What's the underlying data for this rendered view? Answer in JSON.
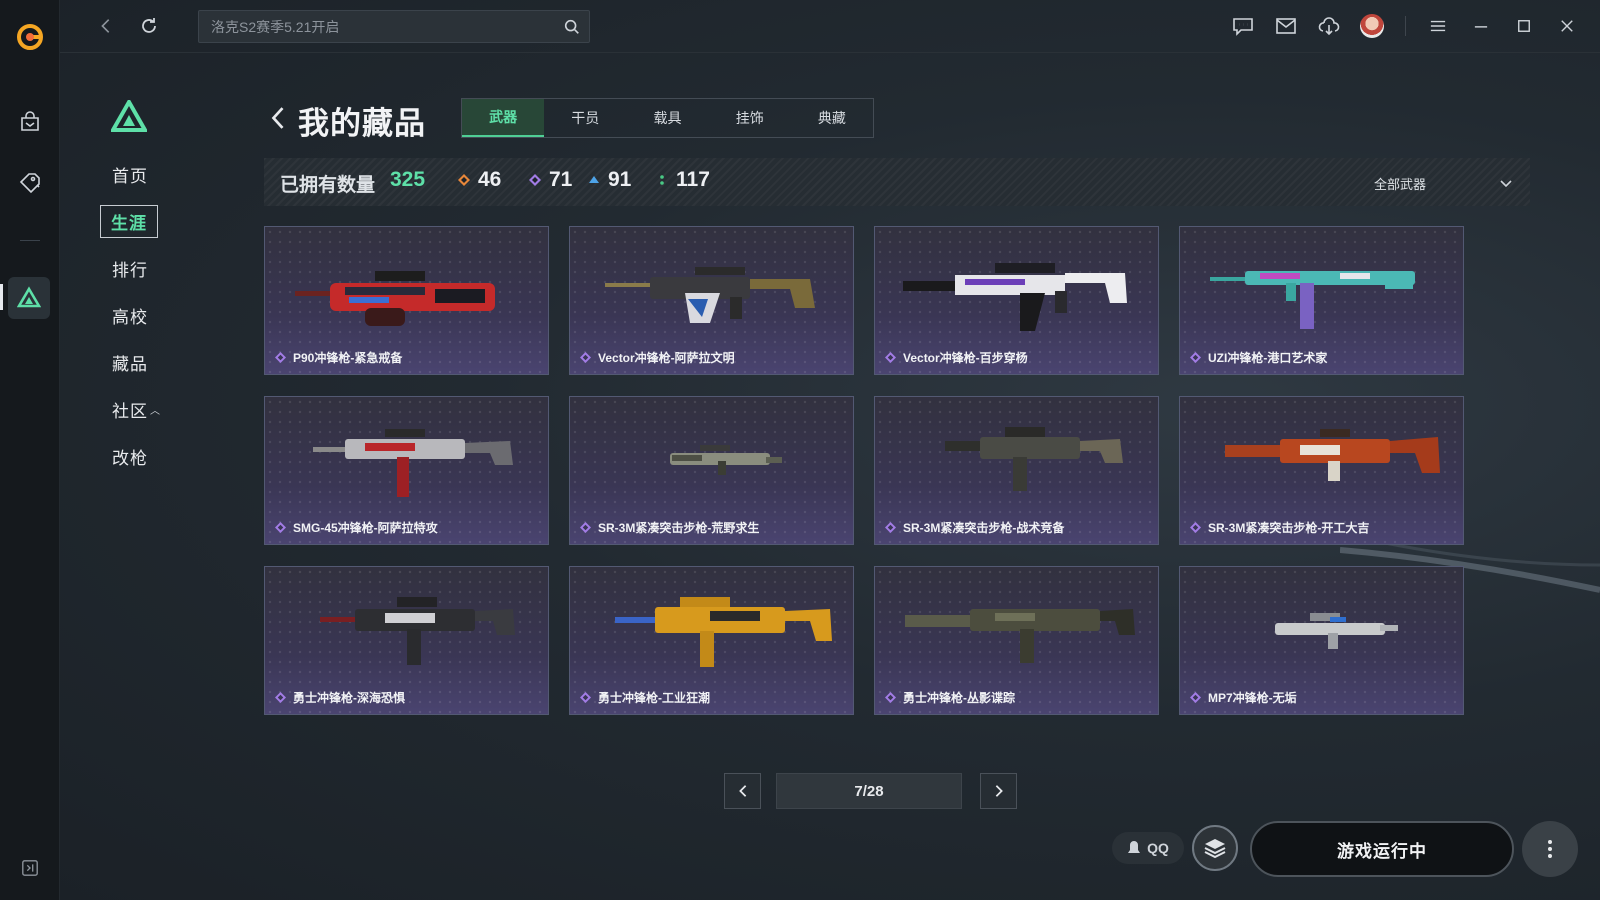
{
  "search": {
    "placeholder": "洛克S2赛季5.21开启"
  },
  "sidebar": {
    "items": [
      {
        "label": "首页"
      },
      {
        "label": "生涯"
      },
      {
        "label": "排行"
      },
      {
        "label": "高校"
      },
      {
        "label": "藏品"
      },
      {
        "label": "社区"
      },
      {
        "label": "改枪"
      }
    ],
    "active": "生涯"
  },
  "page": {
    "title": "我的藏品"
  },
  "tabs": [
    "武器",
    "干员",
    "载具",
    "挂饰",
    "典藏"
  ],
  "active_tab": "武器",
  "stats": {
    "owned_label": "已拥有数量",
    "owned_count": "325",
    "orange": "46",
    "purple": "71",
    "blue": "91",
    "green": "117",
    "filter": "全部武器"
  },
  "colors": {
    "accent_green": "#5ee0a8",
    "rarity_orange": "#e8873a",
    "rarity_purple": "#a27ce6",
    "rarity_blue": "#4da3e8",
    "rarity_green": "#49c985"
  },
  "items": [
    {
      "name": "P90冲锋枪-紧急戒备"
    },
    {
      "name": "Vector冲锋枪-阿萨拉文明"
    },
    {
      "name": "Vector冲锋枪-百步穿杨"
    },
    {
      "name": "UZI冲锋枪-港口艺术家"
    },
    {
      "name": "SMG-45冲锋枪-阿萨拉特攻"
    },
    {
      "name": "SR-3M紧凑突击步枪-荒野求生"
    },
    {
      "name": "SR-3M紧凑突击步枪-战术竞备"
    },
    {
      "name": "SR-3M紧凑突击步枪-开工大吉"
    },
    {
      "name": "勇士冲锋枪-深海恐惧"
    },
    {
      "name": "勇士冲锋枪-工业狂潮"
    },
    {
      "name": "勇士冲锋枪-丛影谍踪"
    },
    {
      "name": "MP7冲锋枪-无垢"
    }
  ],
  "pagination": {
    "current": "7/28"
  },
  "bottom": {
    "qq": "QQ",
    "launch": "游戏运行中"
  }
}
